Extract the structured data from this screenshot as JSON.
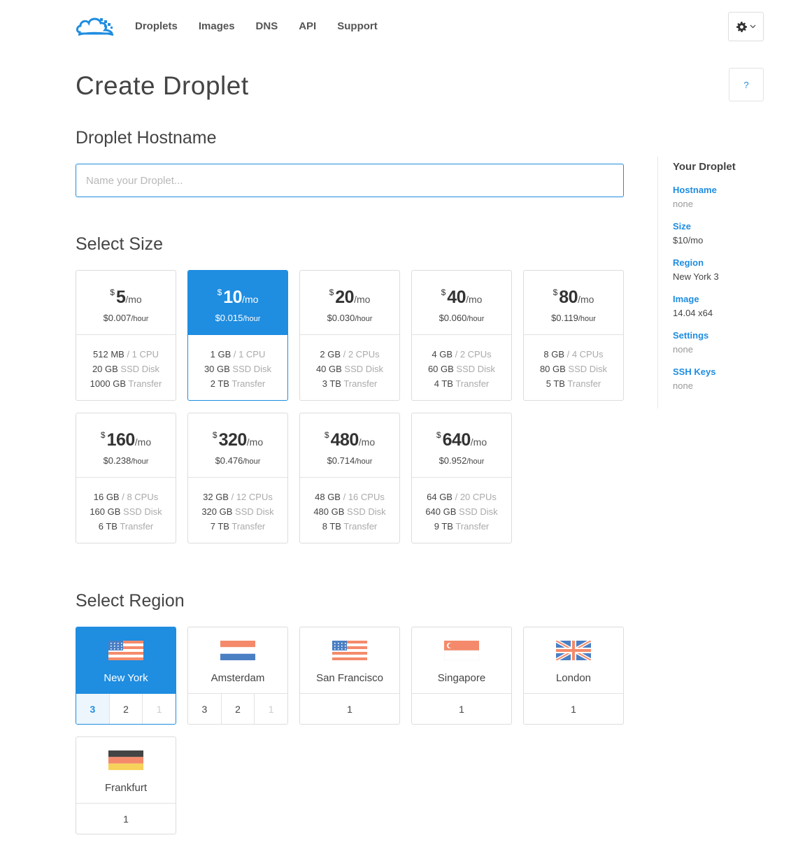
{
  "nav": {
    "links": [
      "Droplets",
      "Images",
      "DNS",
      "API",
      "Support"
    ],
    "settings_icon": "gear-icon",
    "help_label": "?"
  },
  "page_title": "Create Droplet",
  "hostname": {
    "heading": "Droplet Hostname",
    "placeholder": "Name your Droplet...",
    "value": ""
  },
  "size": {
    "heading": "Select Size",
    "currency": "$",
    "per_month": "/mo",
    "per_hour": "/hour",
    "selected": "$10",
    "plans": [
      {
        "price": "5",
        "hourly": "$0.007",
        "mem": "512 MB",
        "cpu": "1 CPU",
        "disk": "20 GB",
        "disk_label": "SSD Disk",
        "transfer": "1000 GB",
        "transfer_label": "Transfer"
      },
      {
        "price": "10",
        "hourly": "$0.015",
        "mem": "1 GB",
        "cpu": "1 CPU",
        "disk": "30 GB",
        "disk_label": "SSD Disk",
        "transfer": "2 TB",
        "transfer_label": "Transfer"
      },
      {
        "price": "20",
        "hourly": "$0.030",
        "mem": "2 GB",
        "cpu": "2 CPUs",
        "disk": "40 GB",
        "disk_label": "SSD Disk",
        "transfer": "3 TB",
        "transfer_label": "Transfer"
      },
      {
        "price": "40",
        "hourly": "$0.060",
        "mem": "4 GB",
        "cpu": "2 CPUs",
        "disk": "60 GB",
        "disk_label": "SSD Disk",
        "transfer": "4 TB",
        "transfer_label": "Transfer"
      },
      {
        "price": "80",
        "hourly": "$0.119",
        "mem": "8 GB",
        "cpu": "4 CPUs",
        "disk": "80 GB",
        "disk_label": "SSD Disk",
        "transfer": "5 TB",
        "transfer_label": "Transfer"
      },
      {
        "price": "160",
        "hourly": "$0.238",
        "mem": "16 GB",
        "cpu": "8 CPUs",
        "disk": "160 GB",
        "disk_label": "SSD Disk",
        "transfer": "6 TB",
        "transfer_label": "Transfer"
      },
      {
        "price": "320",
        "hourly": "$0.476",
        "mem": "32 GB",
        "cpu": "12 CPUs",
        "disk": "320 GB",
        "disk_label": "SSD Disk",
        "transfer": "7 TB",
        "transfer_label": "Transfer"
      },
      {
        "price": "480",
        "hourly": "$0.714",
        "mem": "48 GB",
        "cpu": "16 CPUs",
        "disk": "480 GB",
        "disk_label": "SSD Disk",
        "transfer": "8 TB",
        "transfer_label": "Transfer"
      },
      {
        "price": "640",
        "hourly": "$0.952",
        "mem": "64 GB",
        "cpu": "20 CPUs",
        "disk": "640 GB",
        "disk_label": "SSD Disk",
        "transfer": "9 TB",
        "transfer_label": "Transfer"
      }
    ]
  },
  "region": {
    "heading": "Select Region",
    "regions": [
      {
        "name": "New York",
        "flag": "us-flag-icon",
        "datacenters": [
          "3",
          "2",
          "1"
        ]
      },
      {
        "name": "Amsterdam",
        "flag": "netherlands-flag-icon",
        "datacenters": [
          "3",
          "2",
          "1"
        ]
      },
      {
        "name": "San Francisco",
        "flag": "us-flag-icon",
        "datacenters": [
          "1"
        ]
      },
      {
        "name": "Singapore",
        "flag": "singapore-flag-icon",
        "datacenters": [
          "1"
        ]
      },
      {
        "name": "London",
        "flag": "uk-flag-icon",
        "datacenters": [
          "1"
        ]
      },
      {
        "name": "Frankfurt",
        "flag": "germany-flag-icon",
        "datacenters": [
          "1"
        ]
      }
    ]
  },
  "summary": {
    "title": "Your Droplet",
    "items": [
      {
        "label": "Hostname",
        "value": "none"
      },
      {
        "label": "Size",
        "value": "$10/mo"
      },
      {
        "label": "Region",
        "value": "New York 3"
      },
      {
        "label": "Image",
        "value": "14.04 x64"
      },
      {
        "label": "Settings",
        "value": "none"
      },
      {
        "label": "SSH Keys",
        "value": "none"
      }
    ]
  },
  "colors": {
    "accent": "#1f8de0",
    "border": "#dcdcdc"
  }
}
